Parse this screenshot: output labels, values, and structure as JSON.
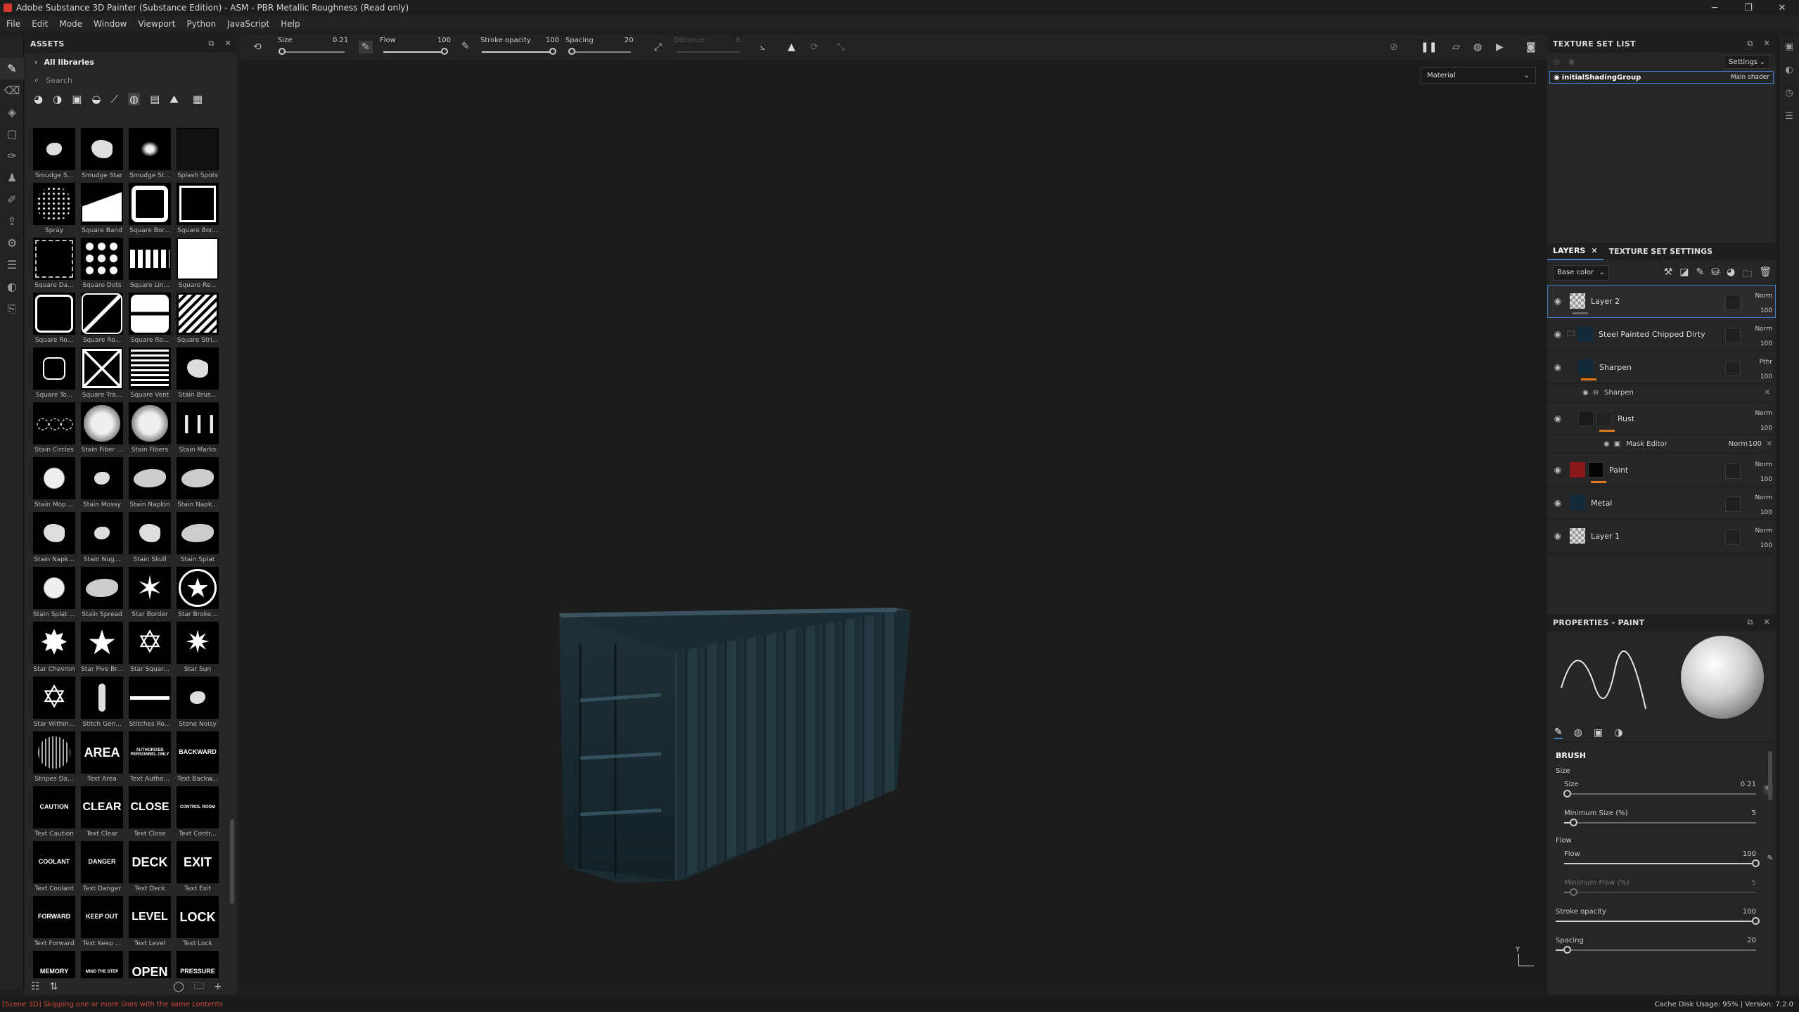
{
  "titlebar": {
    "title": "Adobe Substance 3D Painter (Substance Edition) - ASM - PBR Metallic Roughness (Read only)",
    "min_glyph": "─",
    "max_glyph": "❐",
    "close_glyph": "✕"
  },
  "menu": [
    "File",
    "Edit",
    "Mode",
    "Window",
    "Viewport",
    "Python",
    "JavaScript",
    "Help"
  ],
  "assets": {
    "title": "ASSETS",
    "library": "All libraries",
    "search_placeholder": "Search",
    "items": [
      {
        "label": "Smudge S...",
        "shape": "blob-sm"
      },
      {
        "label": "Smudge Star",
        "shape": "blob"
      },
      {
        "label": "Smudge St...",
        "shape": "blob-sp"
      },
      {
        "label": "Splash Spots",
        "shape": "dark"
      },
      {
        "label": "Spray",
        "shape": "spray"
      },
      {
        "label": "Square Band",
        "shape": "band"
      },
      {
        "label": "Square Bor...",
        "shape": "sqborder"
      },
      {
        "label": "Square Bor...",
        "shape": "sqcorners"
      },
      {
        "label": "Square Da...",
        "shape": "sqdash"
      },
      {
        "label": "Square Dots",
        "shape": "dots"
      },
      {
        "label": "Square Lin...",
        "shape": "teeth"
      },
      {
        "label": "Square Re...",
        "shape": "square"
      },
      {
        "label": "Square Ro...",
        "shape": "sqround"
      },
      {
        "label": "Square Ro...",
        "shape": "slash"
      },
      {
        "label": "Square Ro...",
        "shape": "twobox"
      },
      {
        "label": "Square Stri...",
        "shape": "stripes"
      },
      {
        "label": "Square To...",
        "shape": "roundbox"
      },
      {
        "label": "Square Tra...",
        "shape": "cross"
      },
      {
        "label": "Square Vent",
        "shape": "vent"
      },
      {
        "label": "Stain Brus...",
        "shape": "blob"
      },
      {
        "label": "Stain Circles",
        "shape": "circles"
      },
      {
        "label": "Stain Fiber ...",
        "shape": "bigblob"
      },
      {
        "label": "Stain Fibers",
        "shape": "bigblob"
      },
      {
        "label": "Stain Marks",
        "shape": "marks"
      },
      {
        "label": "Stain Mop ...",
        "shape": "splat"
      },
      {
        "label": "Stain Mossy",
        "shape": "blob-sm"
      },
      {
        "label": "Stain Napkin",
        "shape": "cloud"
      },
      {
        "label": "Stain Napk...",
        "shape": "cloud"
      },
      {
        "label": "Stain Napk...",
        "shape": "blob"
      },
      {
        "label": "Stain Nug...",
        "shape": "blob-sm"
      },
      {
        "label": "Stain Skull",
        "shape": "blob"
      },
      {
        "label": "Stain Splat",
        "shape": "cloud"
      },
      {
        "label": "Stain Splat ...",
        "shape": "splat"
      },
      {
        "label": "Stain Spread",
        "shape": "cloud"
      },
      {
        "label": "Star Border",
        "shape": "star6"
      },
      {
        "label": "Star Broke...",
        "shape": "starcircle"
      },
      {
        "label": "Star Chevron",
        "shape": "star8"
      },
      {
        "label": "Star Five Br...",
        "shape": "star5"
      },
      {
        "label": "Star Squar...",
        "shape": "staroutline"
      },
      {
        "label": "Star Sun",
        "shape": "starsun"
      },
      {
        "label": "Star Within...",
        "shape": "star6o"
      },
      {
        "label": "Stitch Gen...",
        "shape": "stitch"
      },
      {
        "label": "Stitches Ro...",
        "shape": "hline"
      },
      {
        "label": "Stone Noisy",
        "shape": "blob-sm"
      },
      {
        "label": "Stripes Da...",
        "shape": "vstripes"
      },
      {
        "label": "Text Area",
        "text": "AREA"
      },
      {
        "label": "Text Autho...",
        "text": "AUTHORIZED PERSONNEL ONLY"
      },
      {
        "label": "Text Backw...",
        "text": "BACKWARD"
      },
      {
        "label": "Text Caution",
        "text": "CAUTION"
      },
      {
        "label": "Text Clear",
        "text": "CLEAR"
      },
      {
        "label": "Text Close",
        "text": "CLOSE"
      },
      {
        "label": "Text Contr...",
        "text": "CONTROL ROOM"
      },
      {
        "label": "Text Coolant",
        "text": "COOLANT"
      },
      {
        "label": "Text Danger",
        "text": "DANGER"
      },
      {
        "label": "Text Deck",
        "text": "DECK"
      },
      {
        "label": "Text Exit",
        "text": "EXIT"
      },
      {
        "label": "Text Forward",
        "text": "FORWARD"
      },
      {
        "label": "Text Keep ...",
        "text": "KEEP OUT"
      },
      {
        "label": "Text Level",
        "text": "LEVEL"
      },
      {
        "label": "Text Lock",
        "text": "LOCK"
      },
      {
        "label": "",
        "text": "MEMORY"
      },
      {
        "label": "",
        "text": "MIND THE STEP"
      },
      {
        "label": "",
        "text": "OPEN"
      },
      {
        "label": "",
        "text": "PRESSURE"
      }
    ]
  },
  "toolbar": {
    "size_label": "Size",
    "size_value": "0.21",
    "flow_label": "Flow",
    "flow_value": "100",
    "stroke_label": "Stroke opacity",
    "stroke_value": "100",
    "spacing_label": "Spacing",
    "spacing_value": "20",
    "distance_label": "Distance",
    "distance_value": "8"
  },
  "viewport": {
    "material_mode": "Material"
  },
  "texture_set_list": {
    "title": "TEXTURE SET LIST",
    "settings_label": "Settings",
    "sets": [
      {
        "name": "initialShadingGroup",
        "shader": "Main shader"
      }
    ]
  },
  "layers_panel": {
    "tab_layers": "LAYERS",
    "tab_tss": "TEXTURE SET SETTINGS",
    "channel": "Base color",
    "layers": [
      {
        "name": "Layer 2",
        "blend": "Norm",
        "opacity": "100",
        "thumb": "checker",
        "selected": true
      },
      {
        "name": "Steel Painted Chipped Dirty",
        "blend": "Norm",
        "opacity": "100",
        "thumb": "navy",
        "folder": true
      },
      {
        "name": "Sharpen",
        "blend": "Pthr",
        "opacity": "100",
        "thumb": "navy",
        "orange": true,
        "effect": "Sharpen"
      },
      {
        "name": "Rust",
        "blend": "Norm",
        "opacity": "100",
        "thumb": "dark",
        "orange": true,
        "mask": {
          "name": "Mask Editor",
          "blend": "Norm",
          "opacity": "100"
        }
      },
      {
        "name": "Paint",
        "blend": "Norm",
        "opacity": "100",
        "thumb": "red",
        "orange": true
      },
      {
        "name": "Metal",
        "blend": "Norm",
        "opacity": "100",
        "thumb": "navy"
      },
      {
        "name": "Layer 1",
        "blend": "Norm",
        "opacity": "100",
        "thumb": "checker"
      }
    ]
  },
  "properties": {
    "title": "PROPERTIES - PAINT",
    "section": "BRUSH",
    "size_group": "Size",
    "flow_group": "Flow",
    "sliders": {
      "size": {
        "label": "Size",
        "value": "0.21",
        "frac": 0.02
      },
      "min_size": {
        "label": "Minimum Size (%)",
        "value": "5",
        "frac": 0.05
      },
      "flow": {
        "label": "Flow",
        "value": "100",
        "frac": 1.0
      },
      "min_flow": {
        "label": "Minimum Flow (%)",
        "value": "5",
        "frac": 0.05
      },
      "stroke": {
        "label": "Stroke opacity",
        "value": "100",
        "frac": 1.0
      },
      "spacing": {
        "label": "Spacing",
        "value": "20",
        "frac": 0.06
      }
    }
  },
  "statusbar": {
    "message": "[Scene 3D] Skipping one or more lines with the same contents",
    "cache": "Cache Disk Usage:   95% | Version: 7.2.0"
  },
  "colors": {
    "accent": "#3d82c4",
    "orange": "#e07a1f",
    "error": "#d04a3a"
  }
}
